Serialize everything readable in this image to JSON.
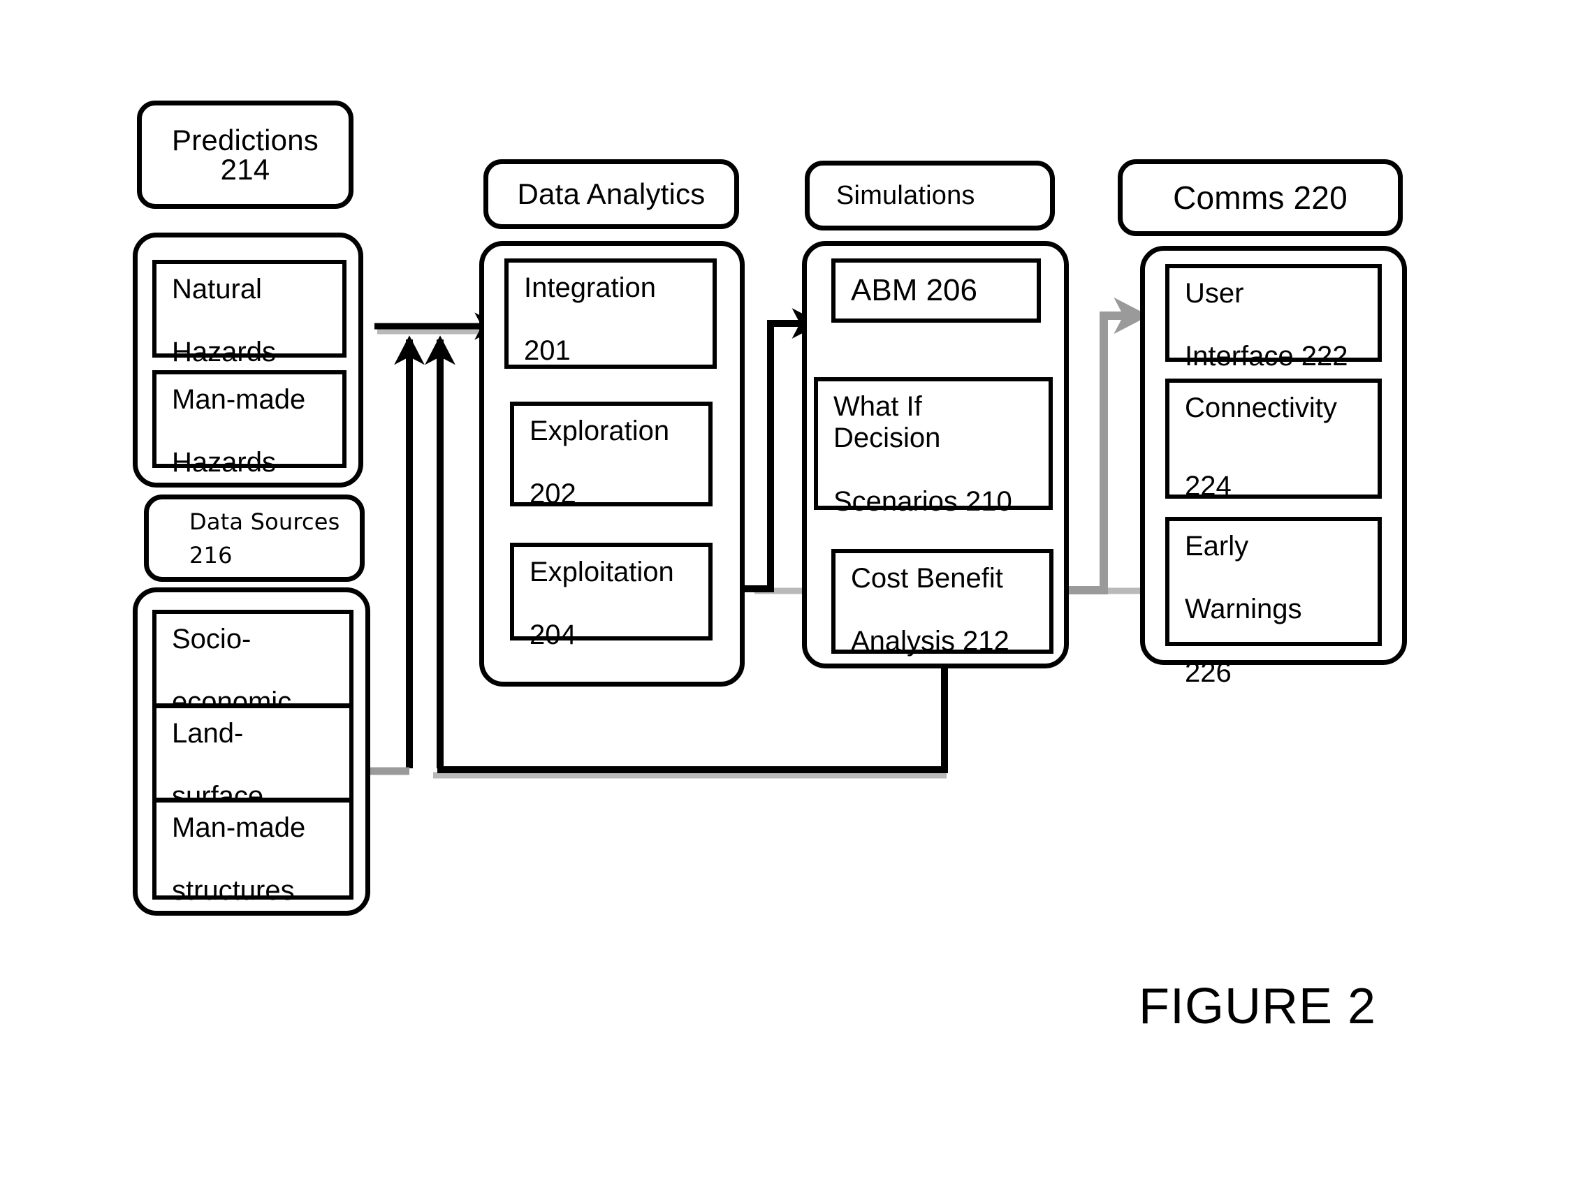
{
  "figure": {
    "caption": "FIGURE 2"
  },
  "colors": {
    "stroke": "#000000",
    "gray": "#9a9a9a",
    "background": "#ffffff"
  },
  "columns": [
    {
      "key": "predictions",
      "header": "Predictions 214",
      "header_line1": "Predictions",
      "header_line2": "214",
      "boxes": [
        {
          "line1": "Natural",
          "line2": "Hazards"
        },
        {
          "line1": "Man-made",
          "line2": "Hazards"
        }
      ]
    },
    {
      "key": "data_sources",
      "header": "Data Sources 216",
      "header_line1": "Data Sources",
      "header_line2": "216",
      "boxes": [
        {
          "line1": "Socio-",
          "line2": "economic"
        },
        {
          "line1": "Land-",
          "line2": "surface"
        },
        {
          "line1": "Man-made",
          "line2": "structures"
        }
      ]
    },
    {
      "key": "data_analytics",
      "header": "Data Analytics",
      "boxes": [
        {
          "line1": "Integration",
          "line2": "201"
        },
        {
          "line1": "Exploration",
          "line2": "202"
        },
        {
          "line1": "Exploitation",
          "line2": "204"
        }
      ]
    },
    {
      "key": "simulations",
      "header": "Simulations",
      "boxes": [
        {
          "line1": "ABM 206",
          "line2": ""
        },
        {
          "line1": "What If Decision",
          "line2": "Scenarios 210"
        },
        {
          "line1": "Cost Benefit",
          "line2": "Analysis 212"
        }
      ]
    },
    {
      "key": "comms",
      "header": "Comms 220",
      "boxes": [
        {
          "line1": "User",
          "line2": "Interface 222"
        },
        {
          "line1": "Connectivity",
          "line2": "224"
        },
        {
          "line1": "Early",
          "line2": "Warnings",
          "line3": "226"
        }
      ]
    }
  ],
  "labels": {
    "predictions_l1": "Predictions",
    "predictions_l2": "214",
    "natural_l1": "Natural",
    "natural_l2": "Hazards",
    "manmade_haz_l1": "Man-made",
    "manmade_haz_l2": "Hazards",
    "datasources_l1": "Data Sources",
    "datasources_l2": "216",
    "socio_l1": "Socio-",
    "socio_l2": "economic",
    "land_l1": "Land-",
    "land_l2": "surface",
    "structures_l1": "Man-made",
    "structures_l2": "structures",
    "analytics_hdr": "Data Analytics",
    "integration_l1": "Integration",
    "integration_l2": "201",
    "exploration_l1": "Exploration",
    "exploration_l2": "202",
    "exploitation_l1": "Exploitation",
    "exploitation_l2": "204",
    "simulations_hdr": "Simulations",
    "abm": "ABM 206",
    "whatif_l1": "What If Decision",
    "whatif_l2": "Scenarios 210",
    "cba_l1": "Cost Benefit",
    "cba_l2": "Analysis 212",
    "comms_hdr": "Comms 220",
    "ui_l1": "User",
    "ui_l2": "Interface 222",
    "conn_l1": "Connectivity",
    "conn_l2": "224",
    "early_l1": "Early",
    "early_l2": "Warnings",
    "early_l3": "226"
  },
  "connections": [
    {
      "from": "Predictions/Data Sources",
      "to": "Integration 201",
      "style": "solid-black-arrow"
    },
    {
      "from": "Integration 201",
      "to": "Exploration 202",
      "style": "solid-black-arrow-down"
    },
    {
      "from": "Exploration 202",
      "to": "Exploitation 204",
      "style": "solid-black-arrow-down"
    },
    {
      "from": "Exploitation 204",
      "to": "ABM 206",
      "style": "solid-black-arrow"
    },
    {
      "from": "ABM 206",
      "to": "What If Decision Scenarios 210",
      "style": "double-headed-zigzag"
    },
    {
      "from": "What If Decision Scenarios 210",
      "to": "Cost Benefit Analysis 212",
      "style": "solid-black-arrow-down"
    },
    {
      "from": "Cost Benefit Analysis 212",
      "to": "User Interface 222",
      "style": "gray-arrow"
    },
    {
      "from": "Cost Benefit Analysis 212",
      "to": "Integration 201 (feedback)",
      "style": "solid-black-feedback"
    },
    {
      "from": "Data Sources",
      "to": "Integration 201 (feedback)",
      "style": "gray-feedback"
    }
  ]
}
